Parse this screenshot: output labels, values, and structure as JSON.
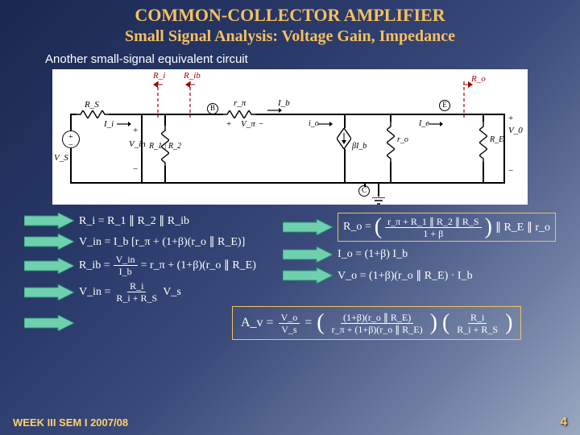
{
  "title1": "COMMON-COLLECTOR AMPLIFIER",
  "title2": "Small Signal Analysis: Voltage Gain, Impedance",
  "caption": "Another small-signal equivalent circuit",
  "circuit": {
    "Rs": "R_S",
    "Vs": "V_S",
    "Ii": "I_i",
    "Vin": "V_in",
    "Ri": "R_i",
    "Rib": "R_ib",
    "B": "B",
    "rpi": "r_π",
    "Vpi": "V_π",
    "Ib": "I_b",
    "R1R2": "R_1 | R_2",
    "betaIb": "βI_b",
    "io": "i_o",
    "ro": "r_o",
    "Ie": "I_e",
    "E": "E",
    "Ro": "R_o",
    "RE": "R_E",
    "Vo": "V_0",
    "C": "C"
  },
  "eq": {
    "l1": "R_i = R_1 ∥ R_2 ∥ R_ib",
    "l2_pre": "V_in = I_b [r_π + (1+β)(r_o ∥ R_E)]",
    "l3_lhs": "R_ib =",
    "l3_num": "V_in",
    "l3_den": "I_b",
    "l3_rhs": "= r_π + (1+β)(r_o ∥ R_E)",
    "l4_pre": "V_in =",
    "l4_num": "R_i",
    "l4_den": "R_i + R_S",
    "l4_post": "V_s",
    "r1_lhs": "R_o =",
    "r1_num": "r_π + R_1 ∥ R_2 ∥ R_S",
    "r1_den": "1 + β",
    "r1_rhs": "∥ R_E ∥ r_o",
    "r2": "I_o = (1+β) I_b",
    "r3": "V_o = (1+β)(r_o ∥ R_E) · I_b",
    "av_lhs": "A_v =",
    "av_f1n": "V_o",
    "av_f1d": "V_s",
    "av_eq": "=",
    "av_f2n": "(1+β)(r_o ∥ R_E)",
    "av_f2d": "r_π + (1+β)(r_o ∥ R_E)",
    "av_f3n": "R_i",
    "av_f3d": "R_i + R_S"
  },
  "footer": "WEEK III SEM I 2007/08",
  "page": "4"
}
